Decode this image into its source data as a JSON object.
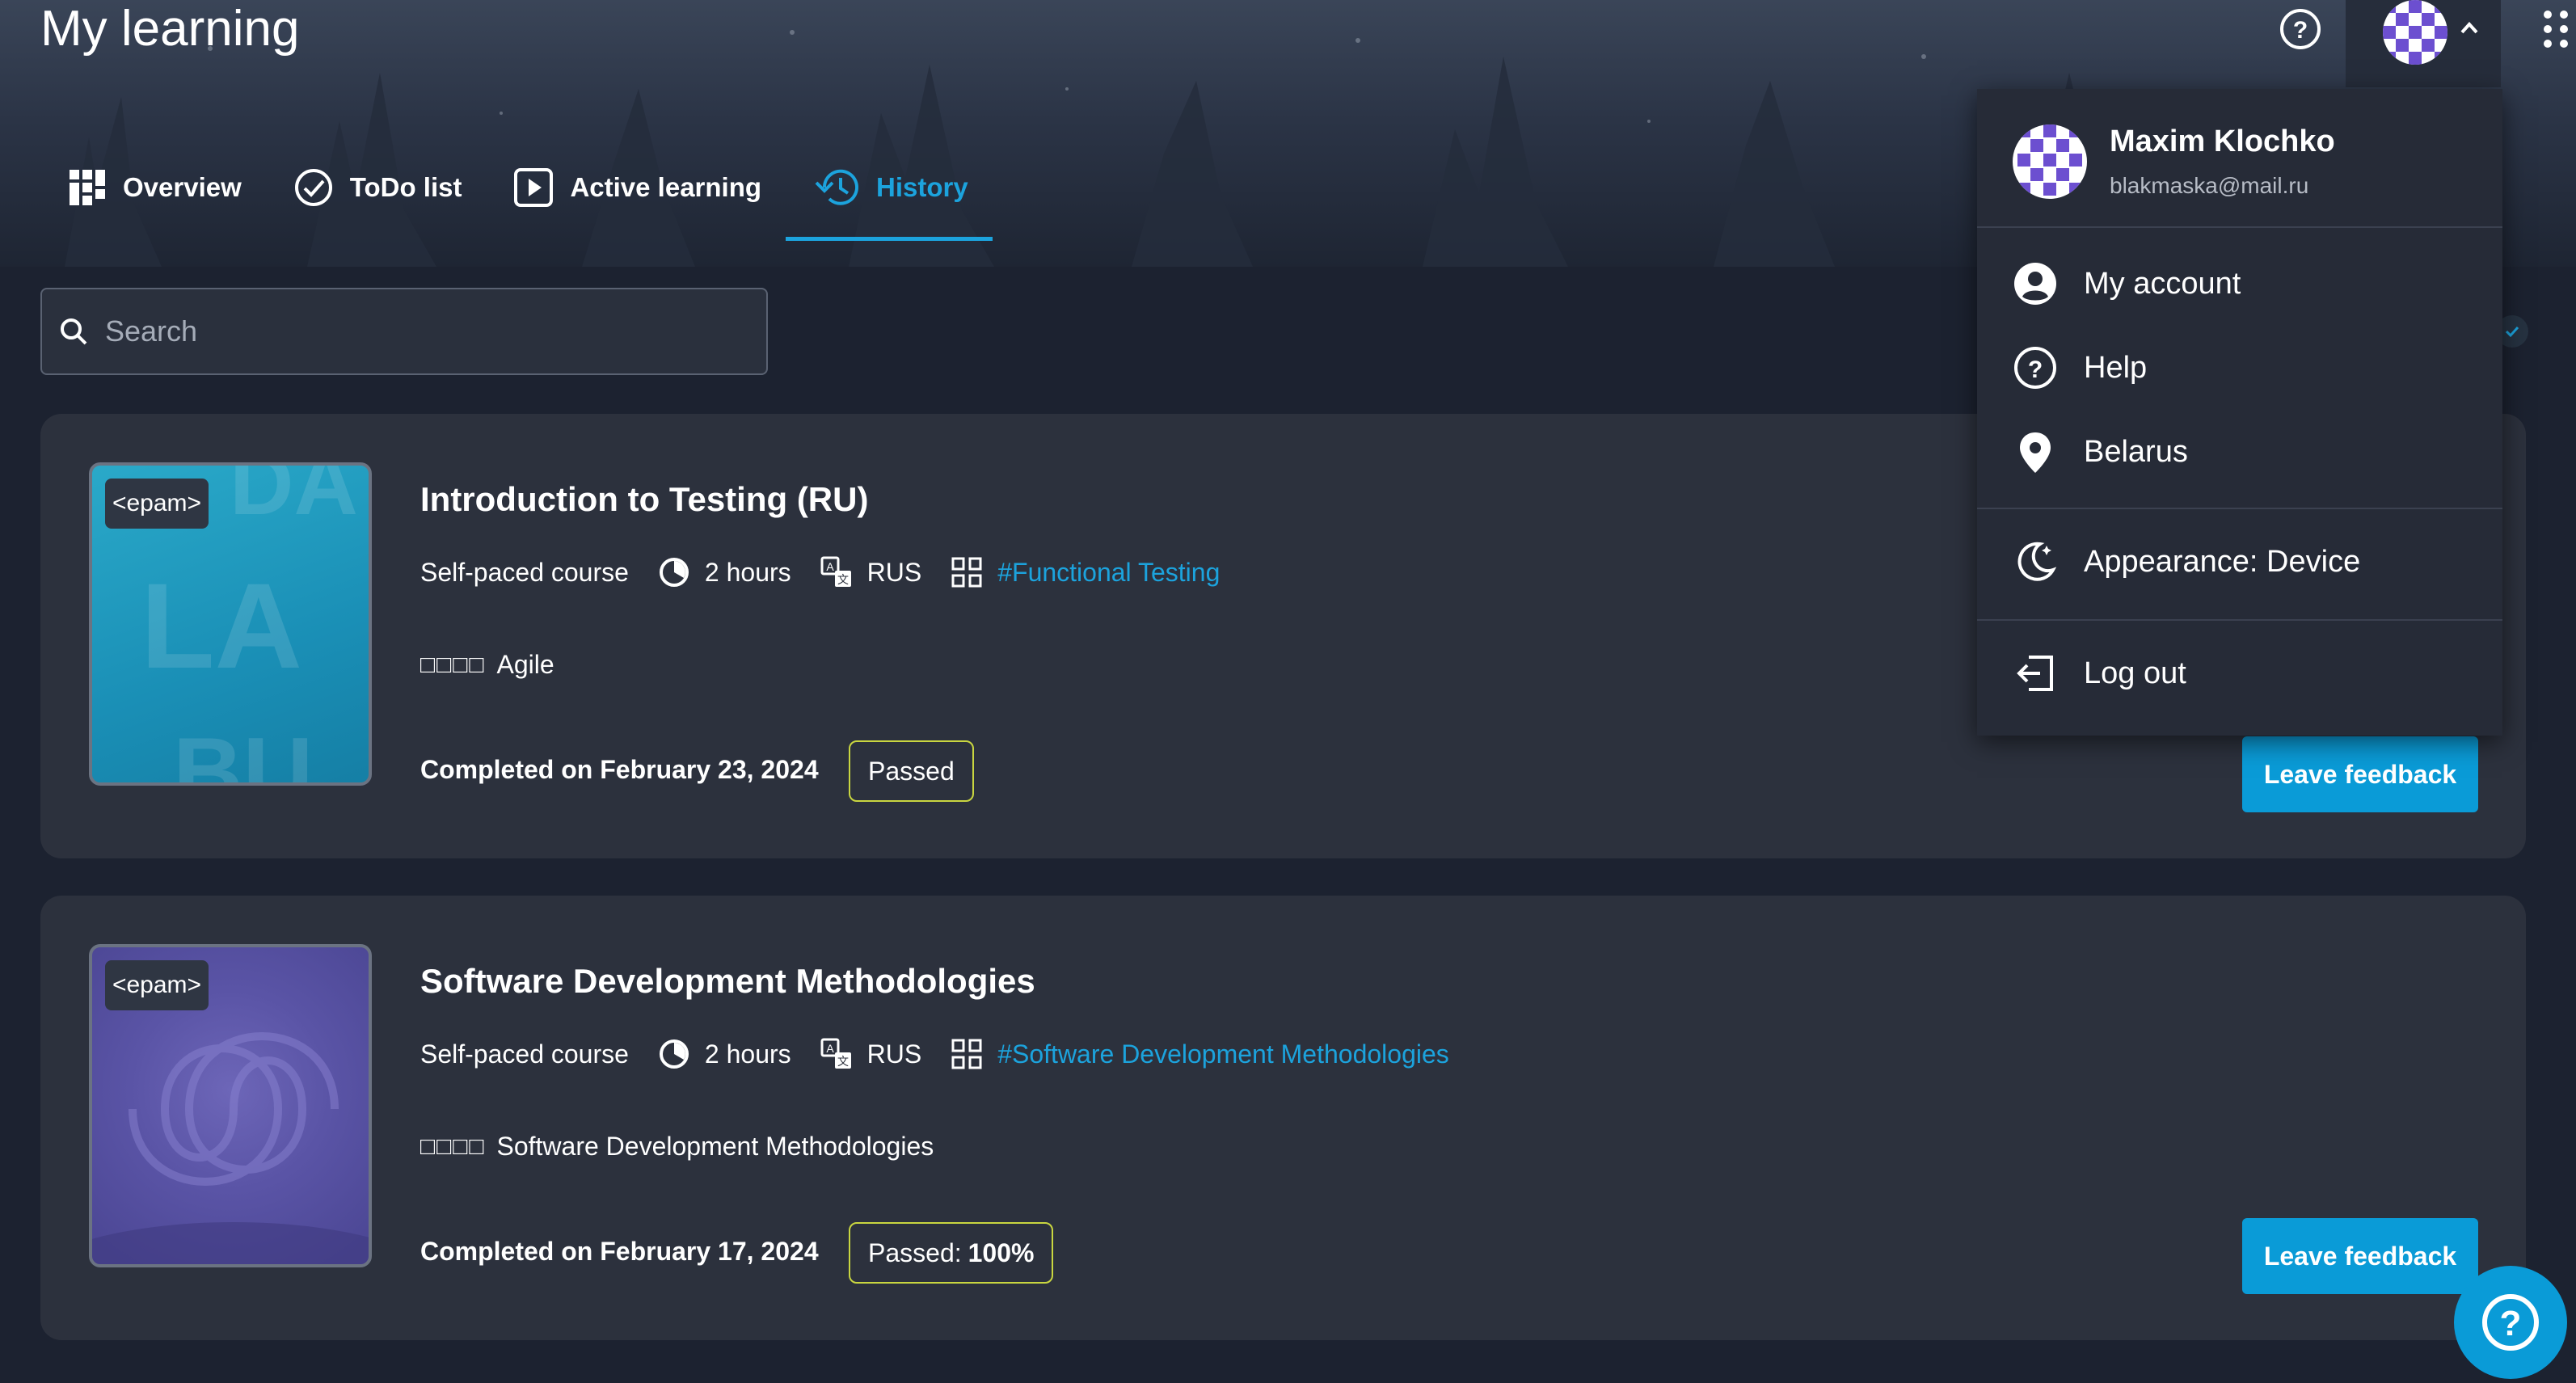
{
  "header": {
    "title": "My learning"
  },
  "tabs": [
    {
      "label": "Overview",
      "icon": "dashboard-icon",
      "active": false
    },
    {
      "label": "ToDo list",
      "icon": "check-circle-icon",
      "active": false
    },
    {
      "label": "Active learning",
      "icon": "play-icon",
      "active": false
    },
    {
      "label": "History",
      "icon": "history-icon",
      "active": true
    }
  ],
  "search": {
    "placeholder": "Search",
    "value": ""
  },
  "courses": [
    {
      "title": "Introduction to Testing (RU)",
      "thumb_logo": "<epam>",
      "type": "Self-paced course",
      "duration": "2 hours",
      "language": "RUS",
      "tag": "#Functional Testing",
      "skill": "Agile",
      "skill_prefix": "□□□□",
      "completed": "Completed on February 23, 2024",
      "status_label": "Passed",
      "status_value": "",
      "feedback_label": "Leave feedback"
    },
    {
      "title": "Software Development Methodologies",
      "thumb_logo": "<epam>",
      "type": "Self-paced course",
      "duration": "2 hours",
      "language": "RUS",
      "tag": "#Software Development Methodologies",
      "skill": "Software Development Methodologies",
      "skill_prefix": "□□□□",
      "completed": "Completed on February 17, 2024",
      "status_label": "Passed:",
      "status_value": "100%",
      "feedback_label": "Leave feedback"
    }
  ],
  "user_menu": {
    "name": "Maxim Klochko",
    "email": "blakmaska@mail.ru",
    "items": [
      {
        "label": "My account",
        "icon": "account-circle-icon"
      },
      {
        "label": "Help",
        "icon": "help-circle-icon"
      },
      {
        "label": "Belarus",
        "icon": "location-pin-icon"
      },
      {
        "label": "Appearance: Device",
        "icon": "moon-icon"
      },
      {
        "label": "Log out",
        "icon": "logout-icon"
      }
    ]
  },
  "colors": {
    "accent": "#1ca3dd",
    "button": "#0a9bd7",
    "status_border": "#c9d640",
    "card_bg": "#2c313d",
    "page_bg": "#1c2230"
  }
}
